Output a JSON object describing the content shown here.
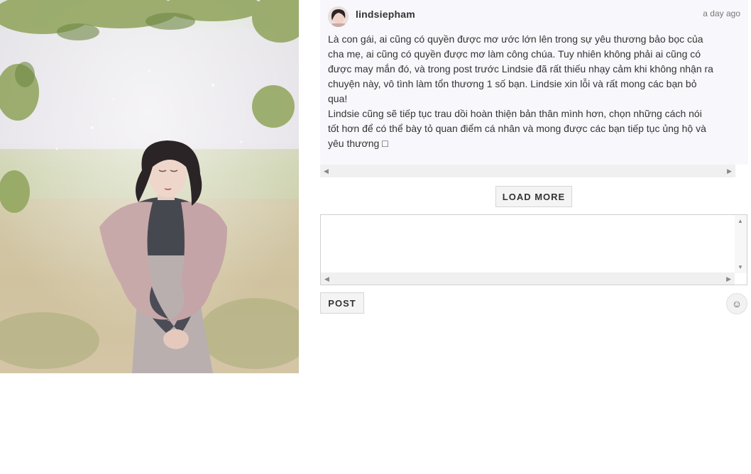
{
  "photo": {
    "alt": ""
  },
  "comment": {
    "username": "lindsiepham",
    "timestamp": "a day ago",
    "text": "Là con gái, ai cũng có quyền được mơ ước lớn lên trong sự yêu thương bảo bọc của\ncha mẹ, ai cũng có quyền được mơ làm công chúa. Tuy nhiên không phải ai cũng có\nđược may mắn đó, và trong post trước Lindsie đã rất thiếu nhạy cảm khi không nhận ra\nchuyện này, vô tình làm tổn thương 1 số bạn. Lindsie xin lỗi và rất mong các bạn bỏ\nqua!\nLindsie cũng sẽ tiếp tục trau dồi hoàn thiện bản thân mình hơn, chọn những cách nói\ntốt hơn để có thể bày tỏ quan điểm cá nhân và mong được các bạn tiếp tục ủng hộ và\nyêu thương □"
  },
  "load_more_label": "LOAD MORE",
  "comment_input": {
    "value": "",
    "placeholder": ""
  },
  "post_label": "POST",
  "emoji_icon": "smiley-icon",
  "colors": {
    "panel_bg": "#f8f7fb",
    "button_bg": "#f4f4f4",
    "text": "#333333"
  }
}
